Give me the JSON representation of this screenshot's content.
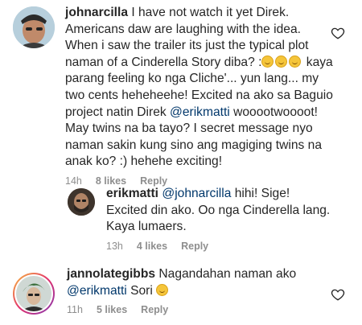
{
  "comments": [
    {
      "username": "johnarcilla",
      "text_1": "I have not watch it yet Direk. Americans daw are laughing with the idea. When i saw the trailer its just the typical plot naman of a Cinderella Story diba? :",
      "text_2": " kaya parang feeling ko nga Cliche'... yun lang... my two cents heheheehe! Excited na ako sa Baguio project natin Direk ",
      "mention": "@erikmatti",
      "text_3": " wooootwoooot! May twins na ba tayo? I secret message nyo naman sakin kung sino ang magiging twins na anak ko? :) hehehe exciting!",
      "time": "14h",
      "likes": "8 likes",
      "reply": "Reply"
    },
    {
      "username": "erikmatti",
      "mention": "@johnarcilla",
      "text": " hihi! Sige! Excited din ako. Oo nga Cinderella lang. Kaya lumaers.",
      "time": "13h",
      "likes": "4 likes",
      "reply": "Reply"
    },
    {
      "username": "jannolategibbs",
      "text_1": " Nagandahan naman ako ",
      "mention": "@erikmatti",
      "text_2": " Sori ",
      "time": "11h",
      "likes": "5 likes",
      "reply": "Reply"
    }
  ],
  "icons": {
    "heart": "heart-outline-icon",
    "emoji_grin": "grinning-face-emoji",
    "emoji_laugh": "laughing-face-emoji"
  }
}
